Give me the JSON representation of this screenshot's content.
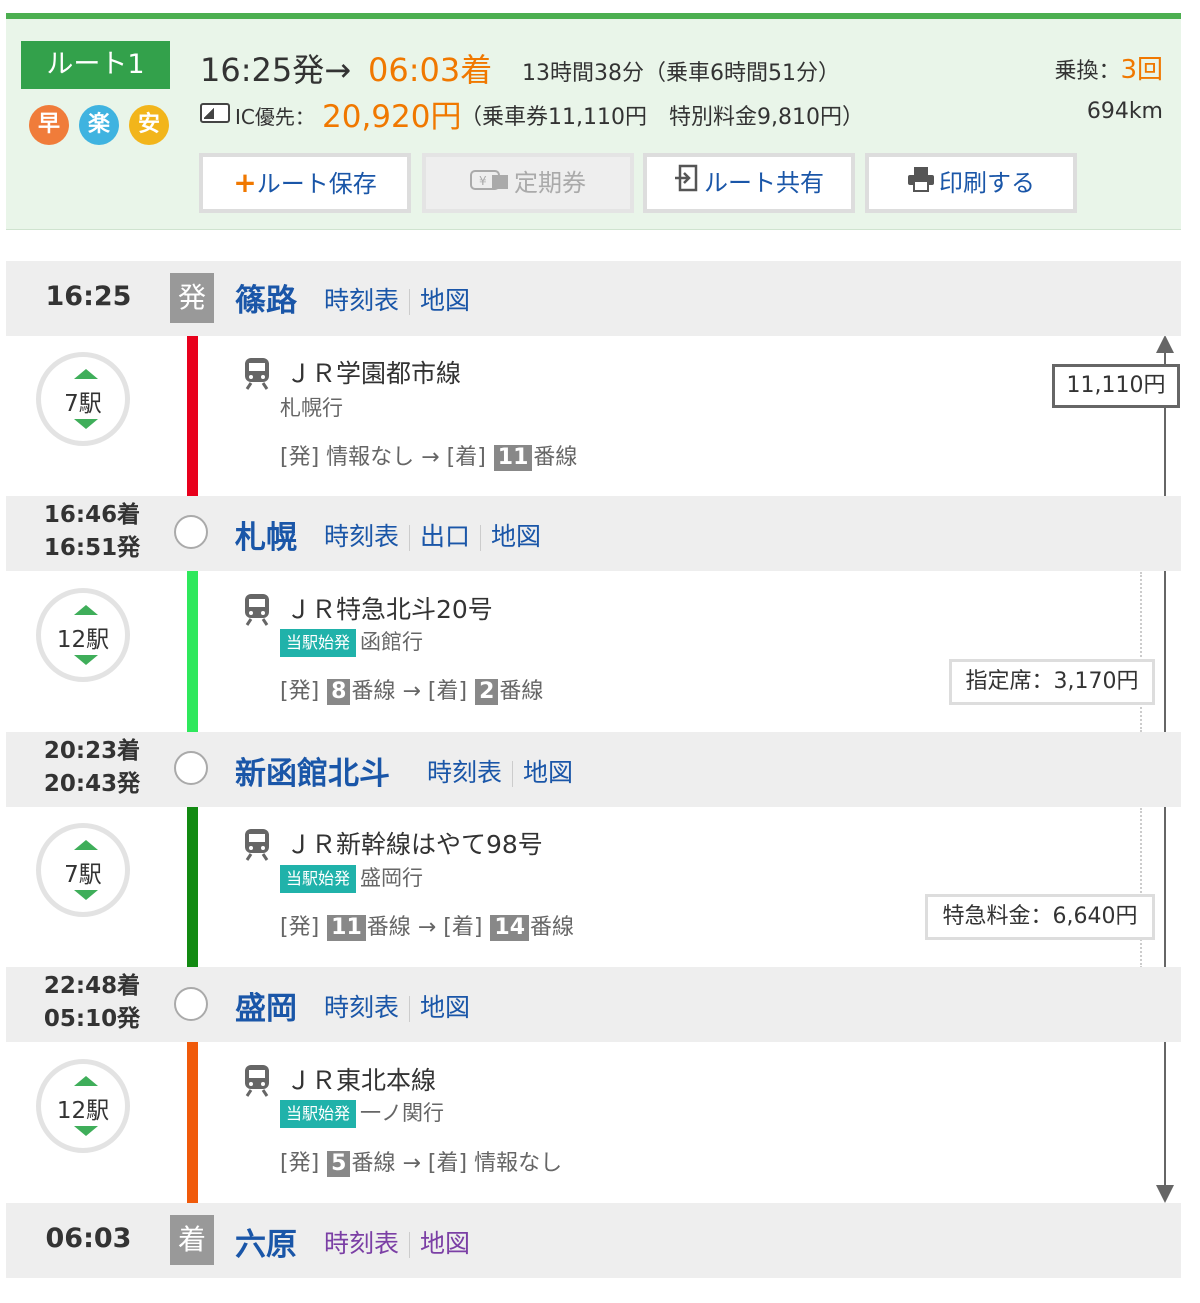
{
  "summary": {
    "route_label": "ルート1",
    "tags": [
      "早",
      "楽",
      "安"
    ],
    "departure": "16:25発→",
    "arrival": "06:03着",
    "duration": "13時間38分（乗車6時間51分）",
    "transfer_label": "乗換：",
    "transfer_count": "3回",
    "ic_label": "IC優先：",
    "fare_total": "20,920円",
    "fare_detail": "（乗車券11,110円　特別料金9,810円）",
    "distance": "694km"
  },
  "buttons": {
    "save": "ルート保存",
    "pass": "定期券",
    "share": "ルート共有",
    "print": "印刷する"
  },
  "stations": [
    {
      "time": "16:25",
      "badge": "発",
      "name": "篠路",
      "links": [
        "時刻表",
        "地図"
      ]
    },
    {
      "arr": "16:46着",
      "dep": "16:51発",
      "name": "札幌",
      "links": [
        "時刻表",
        "出口",
        "地図"
      ]
    },
    {
      "arr": "20:23着",
      "dep": "20:43発",
      "name": "新函館北斗",
      "links": [
        "時刻表",
        "地図"
      ]
    },
    {
      "arr": "22:48着",
      "dep": "05:10発",
      "name": "盛岡",
      "links": [
        "時刻表",
        "地図"
      ]
    },
    {
      "time": "06:03",
      "badge": "着",
      "name": "六原",
      "links": [
        "時刻表",
        "地図"
      ]
    }
  ],
  "segments": [
    {
      "stops": "7駅",
      "line": "ＪＲ学園都市線",
      "shihatsu": "",
      "dest": "札幌行",
      "track_dep_label": "[発]",
      "track_dep_text": "情報なし",
      "track_dep_num": "",
      "track_dep_suffix": "",
      "track_arr_label": "[着]",
      "track_arr_num": "11",
      "track_arr_suffix": "番線",
      "track_arr_text": "",
      "color": "#e8001c",
      "fare": "11,110円"
    },
    {
      "stops": "12駅",
      "line": "ＪＲ特急北斗20号",
      "shihatsu": "当駅始発",
      "dest": "函館行",
      "track_dep_label": "[発]",
      "track_dep_text": "",
      "track_dep_num": "8",
      "track_dep_suffix": "番線",
      "track_arr_label": "[着]",
      "track_arr_num": "2",
      "track_arr_suffix": "番線",
      "track_arr_text": "",
      "color": "#2ee85c",
      "fare": "指定席：3,170円"
    },
    {
      "stops": "7駅",
      "line": "ＪＲ新幹線はやて98号",
      "shihatsu": "当駅始発",
      "dest": "盛岡行",
      "track_dep_label": "[発]",
      "track_dep_text": "",
      "track_dep_num": "11",
      "track_dep_suffix": "番線",
      "track_arr_label": "[着]",
      "track_arr_num": "14",
      "track_arr_suffix": "番線",
      "track_arr_text": "",
      "color": "#128a12",
      "fare": "特急料金：6,640円"
    },
    {
      "stops": "12駅",
      "line": "ＪＲ東北本線",
      "shihatsu": "当駅始発",
      "dest": "一ノ関行",
      "track_dep_label": "[発]",
      "track_dep_text": "",
      "track_dep_num": "5",
      "track_dep_suffix": "番線",
      "track_arr_label": "[着]",
      "track_arr_num": "",
      "track_arr_suffix": "",
      "track_arr_text": "情報なし",
      "color": "#f05a0a",
      "fare": ""
    }
  ],
  "colors": {
    "accent": "#f07800",
    "link": "#1a56a8",
    "route_green": "#33a14b"
  },
  "icons": [
    "plus-icon",
    "pass-icon",
    "share-icon",
    "print-icon",
    "train-icon",
    "ic-card-icon"
  ]
}
